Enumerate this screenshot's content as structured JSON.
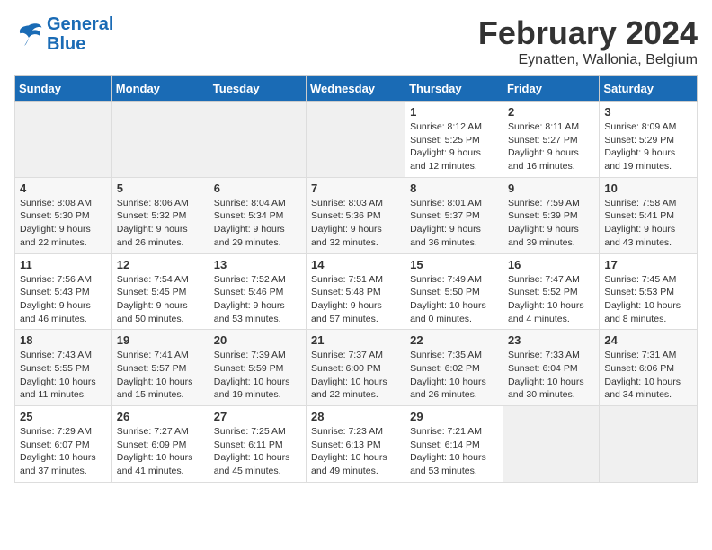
{
  "header": {
    "logo_line1": "General",
    "logo_line2": "Blue",
    "title": "February 2024",
    "subtitle": "Eynatten, Wallonia, Belgium"
  },
  "columns": [
    "Sunday",
    "Monday",
    "Tuesday",
    "Wednesday",
    "Thursday",
    "Friday",
    "Saturday"
  ],
  "weeks": [
    [
      {
        "day": "",
        "info": ""
      },
      {
        "day": "",
        "info": ""
      },
      {
        "day": "",
        "info": ""
      },
      {
        "day": "",
        "info": ""
      },
      {
        "day": "1",
        "info": "Sunrise: 8:12 AM\nSunset: 5:25 PM\nDaylight: 9 hours\nand 12 minutes."
      },
      {
        "day": "2",
        "info": "Sunrise: 8:11 AM\nSunset: 5:27 PM\nDaylight: 9 hours\nand 16 minutes."
      },
      {
        "day": "3",
        "info": "Sunrise: 8:09 AM\nSunset: 5:29 PM\nDaylight: 9 hours\nand 19 minutes."
      }
    ],
    [
      {
        "day": "4",
        "info": "Sunrise: 8:08 AM\nSunset: 5:30 PM\nDaylight: 9 hours\nand 22 minutes."
      },
      {
        "day": "5",
        "info": "Sunrise: 8:06 AM\nSunset: 5:32 PM\nDaylight: 9 hours\nand 26 minutes."
      },
      {
        "day": "6",
        "info": "Sunrise: 8:04 AM\nSunset: 5:34 PM\nDaylight: 9 hours\nand 29 minutes."
      },
      {
        "day": "7",
        "info": "Sunrise: 8:03 AM\nSunset: 5:36 PM\nDaylight: 9 hours\nand 32 minutes."
      },
      {
        "day": "8",
        "info": "Sunrise: 8:01 AM\nSunset: 5:37 PM\nDaylight: 9 hours\nand 36 minutes."
      },
      {
        "day": "9",
        "info": "Sunrise: 7:59 AM\nSunset: 5:39 PM\nDaylight: 9 hours\nand 39 minutes."
      },
      {
        "day": "10",
        "info": "Sunrise: 7:58 AM\nSunset: 5:41 PM\nDaylight: 9 hours\nand 43 minutes."
      }
    ],
    [
      {
        "day": "11",
        "info": "Sunrise: 7:56 AM\nSunset: 5:43 PM\nDaylight: 9 hours\nand 46 minutes."
      },
      {
        "day": "12",
        "info": "Sunrise: 7:54 AM\nSunset: 5:45 PM\nDaylight: 9 hours\nand 50 minutes."
      },
      {
        "day": "13",
        "info": "Sunrise: 7:52 AM\nSunset: 5:46 PM\nDaylight: 9 hours\nand 53 minutes."
      },
      {
        "day": "14",
        "info": "Sunrise: 7:51 AM\nSunset: 5:48 PM\nDaylight: 9 hours\nand 57 minutes."
      },
      {
        "day": "15",
        "info": "Sunrise: 7:49 AM\nSunset: 5:50 PM\nDaylight: 10 hours\nand 0 minutes."
      },
      {
        "day": "16",
        "info": "Sunrise: 7:47 AM\nSunset: 5:52 PM\nDaylight: 10 hours\nand 4 minutes."
      },
      {
        "day": "17",
        "info": "Sunrise: 7:45 AM\nSunset: 5:53 PM\nDaylight: 10 hours\nand 8 minutes."
      }
    ],
    [
      {
        "day": "18",
        "info": "Sunrise: 7:43 AM\nSunset: 5:55 PM\nDaylight: 10 hours\nand 11 minutes."
      },
      {
        "day": "19",
        "info": "Sunrise: 7:41 AM\nSunset: 5:57 PM\nDaylight: 10 hours\nand 15 minutes."
      },
      {
        "day": "20",
        "info": "Sunrise: 7:39 AM\nSunset: 5:59 PM\nDaylight: 10 hours\nand 19 minutes."
      },
      {
        "day": "21",
        "info": "Sunrise: 7:37 AM\nSunset: 6:00 PM\nDaylight: 10 hours\nand 22 minutes."
      },
      {
        "day": "22",
        "info": "Sunrise: 7:35 AM\nSunset: 6:02 PM\nDaylight: 10 hours\nand 26 minutes."
      },
      {
        "day": "23",
        "info": "Sunrise: 7:33 AM\nSunset: 6:04 PM\nDaylight: 10 hours\nand 30 minutes."
      },
      {
        "day": "24",
        "info": "Sunrise: 7:31 AM\nSunset: 6:06 PM\nDaylight: 10 hours\nand 34 minutes."
      }
    ],
    [
      {
        "day": "25",
        "info": "Sunrise: 7:29 AM\nSunset: 6:07 PM\nDaylight: 10 hours\nand 37 minutes."
      },
      {
        "day": "26",
        "info": "Sunrise: 7:27 AM\nSunset: 6:09 PM\nDaylight: 10 hours\nand 41 minutes."
      },
      {
        "day": "27",
        "info": "Sunrise: 7:25 AM\nSunset: 6:11 PM\nDaylight: 10 hours\nand 45 minutes."
      },
      {
        "day": "28",
        "info": "Sunrise: 7:23 AM\nSunset: 6:13 PM\nDaylight: 10 hours\nand 49 minutes."
      },
      {
        "day": "29",
        "info": "Sunrise: 7:21 AM\nSunset: 6:14 PM\nDaylight: 10 hours\nand 53 minutes."
      },
      {
        "day": "",
        "info": ""
      },
      {
        "day": "",
        "info": ""
      }
    ]
  ]
}
